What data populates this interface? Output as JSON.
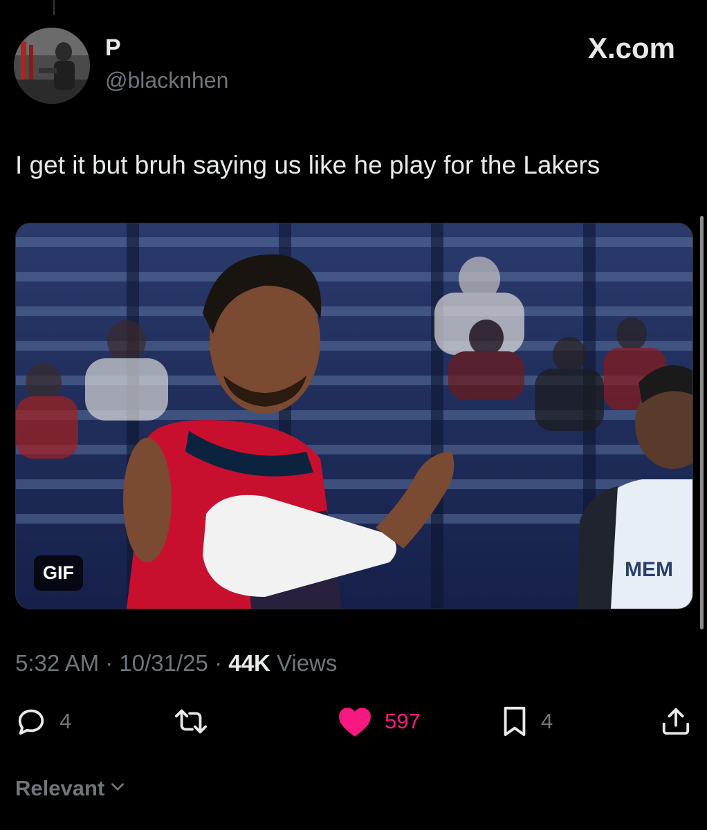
{
  "author": {
    "display_name": "P",
    "handle": "@blacknhen"
  },
  "site_label": "X.com",
  "tweet": {
    "text": "I get it but bruh saying us like he play for the Lakers"
  },
  "media": {
    "badge": "GIF"
  },
  "meta": {
    "time": "5:32 AM",
    "sep1": "·",
    "date": "10/31/25",
    "sep2": "·",
    "views_count": "44K",
    "views_label": "Views"
  },
  "actions": {
    "replies": "4",
    "likes": "597",
    "bookmarks": "4"
  },
  "sort": {
    "label": "Relevant"
  },
  "colors": {
    "background": "#000000",
    "primary_text": "#e7e9ea",
    "secondary_text": "#71767b",
    "like_pink": "#f91880"
  },
  "icons": [
    "reply-icon",
    "retweet-icon",
    "heart-icon",
    "bookmark-icon",
    "share-icon",
    "chevron-down-icon",
    "x-logo-icon"
  ]
}
